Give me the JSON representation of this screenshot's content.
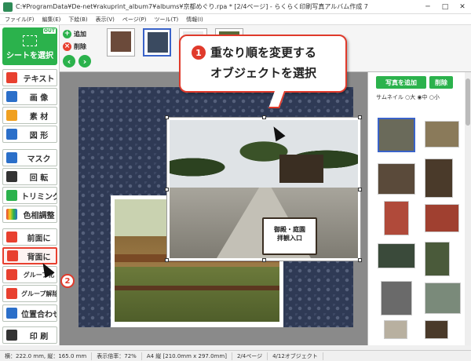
{
  "window": {
    "title": "C:¥ProgramData¥De-net¥rakuprint_album7¥albums¥京都めぐり.rpa * [2/4ページ] - らくらく印刷写真アルバム作成 7"
  },
  "menu": [
    "ファイル(F)",
    "編集(E)",
    "下絵(B)",
    "表示(V)",
    "ページ(P)",
    "ツール(T)",
    "情報(I)"
  ],
  "left": {
    "select_label": "シートを選択",
    "out_badge": "OUT",
    "tools": [
      {
        "label": "テキスト",
        "color": "#e8402f"
      },
      {
        "label": "画 像",
        "color": "#2b6fc9"
      },
      {
        "label": "素 材",
        "color": "#f0a020"
      },
      {
        "label": "図 形",
        "color": "#2b6fc9"
      },
      {
        "label": "マスク",
        "color": "#2b6fc9"
      },
      {
        "label": "回 転",
        "color": "#333333"
      },
      {
        "label": "トリミング",
        "color": "#2bb24c"
      },
      {
        "label": "色相調整",
        "color": "#c94ac9"
      },
      {
        "label": "前面に",
        "color": "#e8402f"
      },
      {
        "label": "背面に",
        "color": "#e8402f"
      },
      {
        "label": "グループ化",
        "color": "#e8402f"
      },
      {
        "label": "グループ解除",
        "color": "#e8402f"
      },
      {
        "label": "位置合わせ",
        "color": "#2b6fc9"
      },
      {
        "label": "印 刷",
        "color": "#333333"
      }
    ]
  },
  "strip": {
    "add_label": "追加",
    "delete_label": "削除"
  },
  "callout": {
    "number": "1",
    "line1": "重なり順を変更する",
    "line2": "オブジェクトを選択"
  },
  "step2": "2",
  "sign": {
    "line1": "御殿・庭園",
    "line2": "拝観入口"
  },
  "right": {
    "add_photo": "写真を追加",
    "delete": "削除",
    "thumb_label": "サムネイル ○大 ◉中 ○小"
  },
  "status": [
    "横：222.0 mm, 縦：165.0 mm",
    "表示倍率：72%",
    "A4 縦 [210.0mm x 297.0mm]",
    "2/4ページ",
    "4/12オブジェクト"
  ],
  "colors": {
    "accent_green": "#2bb24c",
    "highlight_red": "#e03a2b",
    "select_blue": "#3a63c9"
  }
}
